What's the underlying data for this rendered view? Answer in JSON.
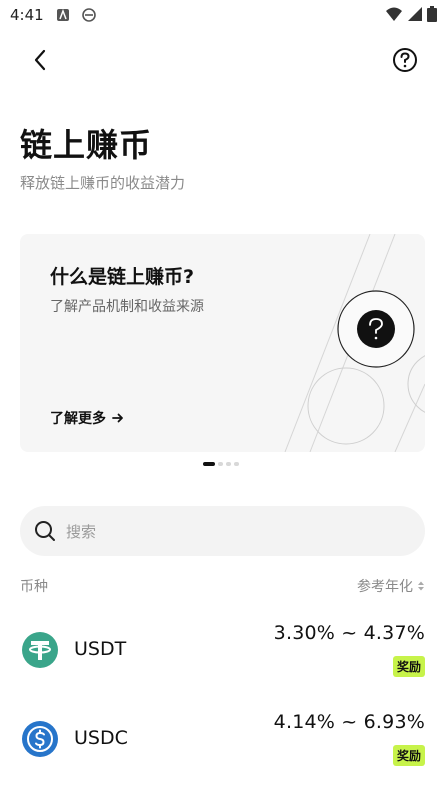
{
  "status_bar": {
    "time": "4:41"
  },
  "nav": {},
  "header": {
    "title": "链上赚币",
    "subtitle": "释放链上赚币的收益潜力"
  },
  "banner": {
    "title": "什么是链上赚币?",
    "description": "了解产品机制和收益来源",
    "link_label": "了解更多"
  },
  "search": {
    "placeholder": "搜索"
  },
  "list": {
    "col_coin": "币种",
    "col_apr": "参考年化",
    "items": [
      {
        "name": "USDT",
        "apr": "3.30% ~ 4.37%",
        "badge": "奖励",
        "color": "#3aa58a",
        "icon": "tether-icon"
      },
      {
        "name": "USDC",
        "apr": "4.14% ~ 6.93%",
        "badge": "奖励",
        "color": "#2775ca",
        "icon": "usdc-icon"
      }
    ]
  },
  "colors": {
    "accent_badge": "#c7f34a",
    "search_bg": "#f3f3f3",
    "banner_bg": "#f6f6f6"
  }
}
